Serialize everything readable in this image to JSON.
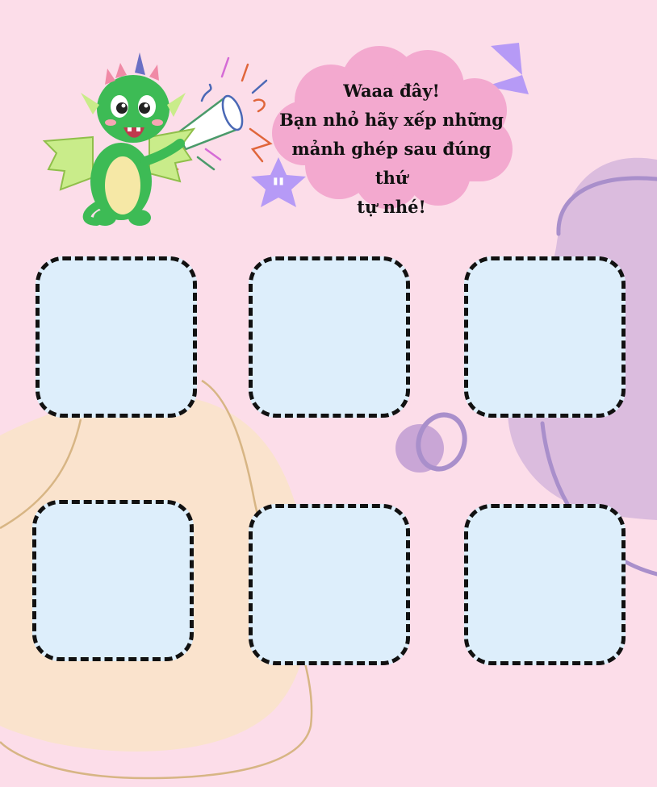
{
  "speech_bubble": {
    "lines": [
      "Waaa đây!",
      "Bạn nhỏ hãy xếp những",
      "mảnh ghép sau đúng thứ",
      "tự nhé!"
    ]
  },
  "mascot": {
    "icon": "dragon-megaphone-icon",
    "body_color": "#3dbb55",
    "wing_color": "#c9ec8a"
  },
  "puzzle_slots": {
    "count": 6,
    "fill_color": "#ddeefb",
    "border_color": "#111111"
  },
  "colors": {
    "background": "#fcdde9",
    "bubble_pink": "#f3a9cf",
    "lavender": "#d9b9dc",
    "peach": "#fae3cd",
    "purple_accent": "#b69af6"
  }
}
